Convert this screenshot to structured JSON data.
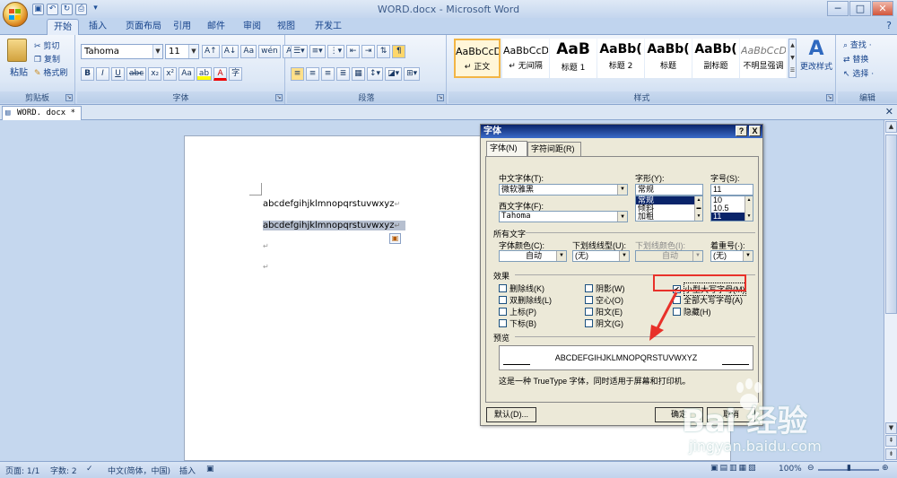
{
  "window": {
    "title": "WORD.docx - Microsoft Word",
    "controls": [
      "─",
      "□",
      "✕"
    ]
  },
  "qat": [
    "save",
    "undo",
    "redo",
    "print"
  ],
  "tabs": [
    "开始",
    "插入",
    "页面布局",
    "引用",
    "邮件",
    "审阅",
    "视图",
    "开发工具"
  ],
  "ribbon": {
    "clipboard": {
      "label": "剪贴板",
      "paste": "粘贴",
      "cut": "剪切",
      "copy": "复制",
      "format_painter": "格式刷"
    },
    "font": {
      "label": "字体",
      "font_name": "Tahoma",
      "font_size": "11",
      "grow": "A↑",
      "shrink": "A↓",
      "clear": "Aa",
      "phonetic": "wén",
      "border": "A",
      "bold": "B",
      "italic": "I",
      "underline": "U",
      "strike": "abc",
      "sub": "x₂",
      "sup": "x²",
      "case": "Aa",
      "highlight": "ab",
      "color": "A",
      "circle": "字"
    },
    "paragraph": {
      "label": "段落"
    },
    "styles": {
      "label": "样式",
      "items": [
        {
          "sample": "AaBbCcD",
          "name": "↵ 正文"
        },
        {
          "sample": "AaBbCcD",
          "name": "↵ 无间隔"
        },
        {
          "sample": "AaB",
          "name": "标题 1"
        },
        {
          "sample": "AaBb(",
          "name": "标题 2"
        },
        {
          "sample": "AaBb(",
          "name": "标题"
        },
        {
          "sample": "AaBb(",
          "name": "副标题"
        },
        {
          "sample": "AaBbCcD",
          "name": "不明显强调"
        }
      ],
      "change": "更改样式"
    },
    "editing": {
      "label": "编辑",
      "find": "查找 ·",
      "replace": "替换",
      "select": "选择 ·"
    }
  },
  "doc_tab": "WORD. docx  *",
  "document": {
    "line1": "abcdefgihjklmnopqrstuvwxyz",
    "line2": "abcdefgihjklmnopqrstuvwxyz",
    "mark": "↵"
  },
  "dialog": {
    "title": "字体",
    "help": "?",
    "close": "X",
    "tabs": [
      "字体(N)",
      "字符间距(R)"
    ],
    "cn_font_label": "中文字体(T):",
    "cn_font": "微软雅黑",
    "style_label": "字形(Y):",
    "style_value": "常规",
    "style_list": [
      "常规",
      "倾斜",
      "加粗"
    ],
    "size_label": "字号(S):",
    "size_value": "11",
    "size_list": [
      "10",
      "10.5",
      "11"
    ],
    "west_font_label": "西文字体(F):",
    "west_font": "Tahoma",
    "all_text": "所有文字",
    "color_label": "字体颜色(C):",
    "color_value": "自动",
    "underline_label": "下划线线型(U):",
    "underline_value": "(无)",
    "ucolor_label": "下划线颜色(I):",
    "ucolor_value": "自动",
    "emph_label": "着重号(·):",
    "emph_value": "(无)",
    "effects": "效果",
    "checks": [
      {
        "label": "删除线(K)",
        "checked": false
      },
      {
        "label": "双删除线(L)",
        "checked": false
      },
      {
        "label": "上标(P)",
        "checked": false
      },
      {
        "label": "下标(B)",
        "checked": false
      },
      {
        "label": "阴影(W)",
        "checked": false
      },
      {
        "label": "空心(O)",
        "checked": false
      },
      {
        "label": "阳文(E)",
        "checked": false
      },
      {
        "label": "阴文(G)",
        "checked": false
      },
      {
        "label": "小型大写字母(M)",
        "checked": true
      },
      {
        "label": "全部大写字母(A)",
        "checked": false
      },
      {
        "label": "隐藏(H)",
        "checked": false
      }
    ],
    "preview_label": "预览",
    "preview_text": "ABCDEFGIHJKLMNOPQRSTUVWXYZ",
    "note": "这是一种 TrueType 字体，同时适用于屏幕和打印机。",
    "default_btn": "默认(D)...",
    "ok_btn": "确定",
    "cancel_btn": "取消"
  },
  "status": {
    "page": "页面: 1/1",
    "words": "字数: 2",
    "lang": "中文(简体，中国)",
    "mode": "插入",
    "zoom": "100%"
  },
  "watermark": {
    "brand": "Bai 经验",
    "url": "jingyan.baidu.com"
  }
}
